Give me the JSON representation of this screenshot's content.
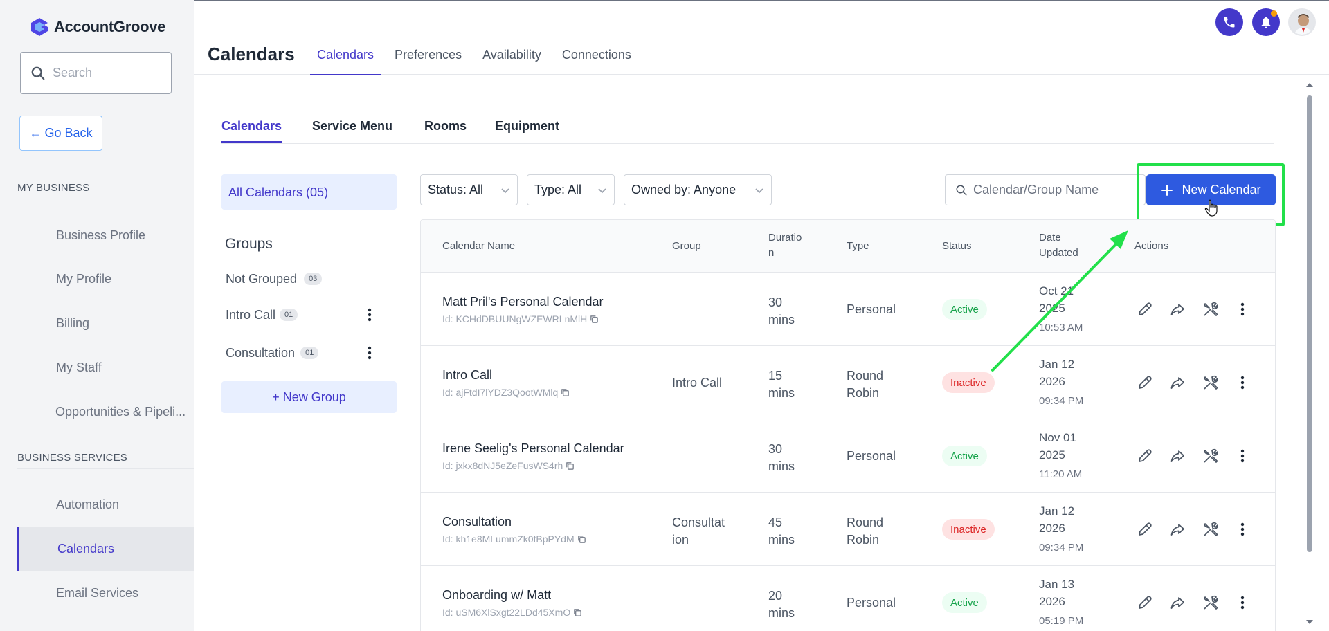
{
  "app": {
    "name": "AccountGroove"
  },
  "sidebar": {
    "search_placeholder": "Search",
    "go_back": "Go Back",
    "sections": [
      {
        "label": "MY BUSINESS",
        "items": [
          "Business Profile",
          "My Profile",
          "Billing",
          "My Staff",
          "Opportunities & Pipeli..."
        ]
      },
      {
        "label": "BUSINESS SERVICES",
        "items": [
          "Automation",
          "Calendars",
          "Email Services"
        ]
      }
    ],
    "active_item": "Calendars"
  },
  "header": {
    "title": "Calendars",
    "tabs": [
      "Calendars",
      "Preferences",
      "Availability",
      "Connections"
    ],
    "active_tab": "Calendars"
  },
  "sub_tabs": {
    "items": [
      "Calendars",
      "Service Menu",
      "Rooms",
      "Equipment"
    ],
    "active": "Calendars"
  },
  "groups_panel": {
    "all_calendars": "All Calendars (05)",
    "title": "Groups",
    "groups": [
      {
        "name": "Not Grouped",
        "count": "03"
      },
      {
        "name": "Intro Call",
        "count": "01"
      },
      {
        "name": "Consultation",
        "count": "01"
      }
    ],
    "new_group": "+ New Group"
  },
  "filters": {
    "status": "Status: All",
    "type": "Type: All",
    "owned_by": "Owned by: Anyone",
    "search_placeholder": "Calendar/Group Name",
    "new_calendar": "New Calendar"
  },
  "table": {
    "headers": {
      "name": "Calendar Name",
      "group": "Group",
      "duration_line1": "Duratio",
      "duration_line2": "n",
      "type": "Type",
      "status": "Status",
      "date_line1": "Date",
      "date_line2": "Updated",
      "actions": "Actions"
    },
    "rows": [
      {
        "name": "Matt Pril's Personal Calendar",
        "id": "Id: KCHdDBUUNgWZEWRLnMlH",
        "group1": "",
        "group2": "",
        "dur1": "30",
        "dur2": "mins",
        "type1": "Personal",
        "type2": "",
        "status": "Active",
        "date1": "Oct 21",
        "date2": "2025",
        "time": "10:53 AM"
      },
      {
        "name": "Intro Call",
        "id": "Id: ajFtdI7lYDZ3QootWMlq",
        "group1": "Intro Call",
        "group2": "",
        "dur1": "15",
        "dur2": "mins",
        "type1": "Round",
        "type2": "Robin",
        "status": "Inactive",
        "date1": "Jan 12",
        "date2": "2026",
        "time": "09:34 PM"
      },
      {
        "name": "Irene Seelig's Personal Calendar",
        "id": "Id: jxkx8dNJ5eZeFusWS4rh",
        "group1": "",
        "group2": "",
        "dur1": "30",
        "dur2": "mins",
        "type1": "Personal",
        "type2": "",
        "status": "Active",
        "date1": "Nov 01",
        "date2": "2025",
        "time": "11:20 AM"
      },
      {
        "name": "Consultation",
        "id": "Id: kh1e8MLummZk0fBpPYdM",
        "group1": "Consultat",
        "group2": "ion",
        "dur1": "45",
        "dur2": "mins",
        "type1": "Round",
        "type2": "Robin",
        "status": "Inactive",
        "date1": "Jan 12",
        "date2": "2026",
        "time": "09:34 PM"
      },
      {
        "name": "Onboarding w/ Matt",
        "id": "Id: uSM6XlSxgt22LDd45XmO",
        "group1": "",
        "group2": "",
        "dur1": "20",
        "dur2": "mins",
        "type1": "Personal",
        "type2": "",
        "status": "Active",
        "date1": "Jan 13",
        "date2": "2026",
        "time": "05:19 PM"
      }
    ]
  },
  "colors": {
    "brand": "#4338ca",
    "primary_button": "#2e5ae0",
    "highlight": "#22e04a",
    "active": "#16a34a",
    "inactive": "#dc2626"
  }
}
